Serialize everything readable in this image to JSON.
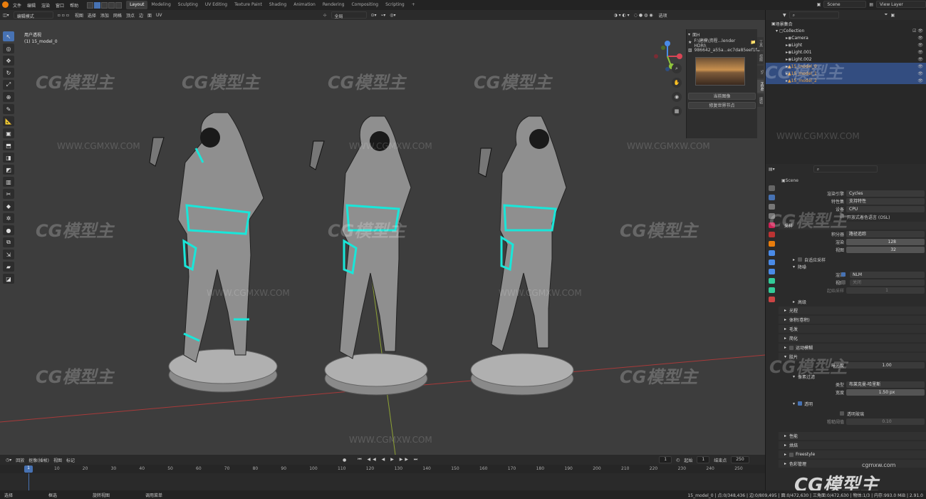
{
  "topbar": {
    "menu": [
      "文件",
      "编辑",
      "渲染",
      "窗口",
      "帮助"
    ],
    "workspaces": [
      "Layout",
      "Modeling",
      "Sculpting",
      "UV Editing",
      "Texture Paint",
      "Shading",
      "Animation",
      "Rendering",
      "Compositing",
      "Scripting"
    ],
    "active_workspace": "Layout",
    "add_tab": "+",
    "scene": "Scene",
    "view_layer": "View Layer"
  },
  "viewport": {
    "mode": "编辑模式",
    "menus": [
      "视图",
      "选择",
      "添加",
      "网格",
      "顶点",
      "边",
      "面",
      "UV"
    ],
    "orientation": "全局",
    "options": "选项",
    "view_name": "用户透视",
    "object_name": "(1) 15_model_0"
  },
  "npanel": {
    "title": "面H",
    "file": "F:\\建模\\资程...lender HDRI\\",
    "hdri": "986642_a55a...ec7da85eef1fd",
    "prev_label": "当前图像",
    "update_label": "修复世界节点",
    "tabs": [
      "工具",
      "视图",
      "Sh",
      "HDRI",
      "编辑"
    ]
  },
  "outliner": {
    "title": "场景集合",
    "collection": "Collection",
    "items": [
      {
        "name": "Camera",
        "selected": false,
        "orange": false
      },
      {
        "name": "Light",
        "selected": false,
        "orange": false
      },
      {
        "name": "Light.001",
        "selected": false,
        "orange": false
      },
      {
        "name": "Light.002",
        "selected": false,
        "orange": false
      },
      {
        "name": "15_model_0",
        "selected": true,
        "orange": true
      },
      {
        "name": "15_model_1",
        "selected": true,
        "orange": true
      },
      {
        "name": "15_model_2",
        "selected": true,
        "orange": true
      }
    ]
  },
  "properties": {
    "scene": "Scene",
    "rows": [
      {
        "label": "渲染引擎",
        "value": "Cycles"
      },
      {
        "label": "特性集",
        "value": "支持特性"
      },
      {
        "label": "设备",
        "value": "CPU"
      }
    ],
    "osl": "开放式着色语言 (OSL)",
    "sampling": "采样",
    "integrator_label": "积分器",
    "integrator": "路径追踪",
    "render_label": "渲染",
    "render_samples": "128",
    "viewport_label": "视图",
    "viewport_samples": "32",
    "adaptive": "自适应采样",
    "denoise": "降噪",
    "denoise_render": "渲染",
    "denoise_render_val": "NLM",
    "denoise_view": "视图",
    "denoise_view_val": "关闭",
    "start_samples_label": "起始采样",
    "start_samples": "1",
    "advanced": "高级",
    "lightpaths": "光程",
    "volumes": "体积(卷积)",
    "hair": "毛发",
    "simplify": "简化",
    "motion_blur": "运动模糊",
    "film": "胶片",
    "exposure_label": "曝光度",
    "exposure": "1.00",
    "pixel_filter": "像素过滤",
    "filter_type_label": "类型",
    "filter_type": "布莱克曼-哈里斯",
    "filter_width_label": "宽度",
    "filter_width": "1.50 px",
    "transparent": "透明",
    "transparent_glass": "透明玻璃",
    "roughness_label": "粗糙阈值",
    "roughness": "0.10",
    "performance": "性能",
    "bake": "烘焙",
    "freestyle": "Freestyle",
    "color_mgmt": "色彩管理"
  },
  "timeline": {
    "menus": [
      "回放",
      "抠像(插帧)",
      "视图",
      "标记"
    ],
    "current_frame": "1",
    "start_label": "起始",
    "start": "1",
    "end_label": "结束点",
    "end": "250",
    "ticks": [
      "10",
      "20",
      "30",
      "40",
      "50",
      "60",
      "70",
      "80",
      "90",
      "100",
      "110",
      "120",
      "130",
      "140",
      "150",
      "160",
      "170",
      "180",
      "190",
      "200",
      "210",
      "220",
      "230",
      "240",
      "250"
    ],
    "cursor": "1"
  },
  "statusbar": {
    "left": "选择",
    "mid1": "框选",
    "mid2": "旋转视图",
    "mid3": "调用菜单",
    "right": "15_model_0 | 点:0/348,436 | 边:0/809,495 | 面:0/472,630 | 三角面:0/472,630 | 物体:1/3 | 内存:993.0 MiB | 2.91.0"
  },
  "watermark": {
    "text": "CG模型主",
    "url": "WWW.CGMXW.COM",
    "corner": "CG模型主",
    "corner_url": "cgmxw.com"
  },
  "colors": {
    "accent": "#4772b3",
    "selection": "#334d80",
    "grid_red": "#a83a3a",
    "grid_green": "#8ea235",
    "mesh_cyan": "#19e6d9"
  }
}
